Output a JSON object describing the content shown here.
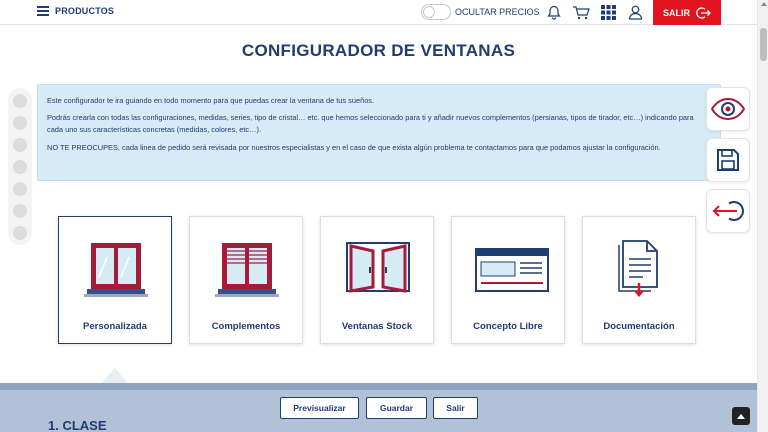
{
  "topbar": {
    "menu_label": "PRODUCTOS",
    "toggle_label": "OCULTAR PRECIOS",
    "exit_label": "SALIR",
    "icons": [
      "bell-icon",
      "cart-icon",
      "grid-icon",
      "user-icon",
      "logout-icon"
    ]
  },
  "page": {
    "title": "CONFIGURADOR DE VENTANAS"
  },
  "info": {
    "line1": "Este configurador te ira guiando en todo momento para que puedas crear la ventana de tus sueños.",
    "line2": "Podrás crearla con todas las configuraciones, medidas, series, tipo de cristal… etc. que hemos seleccionado para ti y añadir nuevos complementos (persianas, tipos de tirador, etc…) indicando para cada uno sus características concretas (medidas, colores, etc…).",
    "line3": "NO TE PREOCUPES, cada linea de pedido será revisada por nuestros especialistas y en el caso de que exista algún problema te contactamos para que podamos ajustar la configuración."
  },
  "cards": [
    {
      "label": "Personalizada",
      "icon": "window-custom-icon",
      "active": true
    },
    {
      "label": "Complementos",
      "icon": "window-blinds-icon",
      "active": false
    },
    {
      "label": "Ventanas Stock",
      "icon": "window-open-icon",
      "active": false
    },
    {
      "label": "Concepto Libre",
      "icon": "browser-window-icon",
      "active": false
    },
    {
      "label": "Documentación",
      "icon": "document-download-icon",
      "active": false
    }
  ],
  "side_actions": [
    "eye-icon",
    "save-icon",
    "exit-arrow-icon"
  ],
  "bottom": {
    "section_title": "1. CLASE",
    "buttons": {
      "preview": "Previsualizar",
      "save": "Guardar",
      "exit": "Salir"
    }
  },
  "colors": {
    "navy": "#1f3d70",
    "red": "#e1131e",
    "info_bg": "#d5ebf5",
    "window_red": "#a51c3a"
  }
}
